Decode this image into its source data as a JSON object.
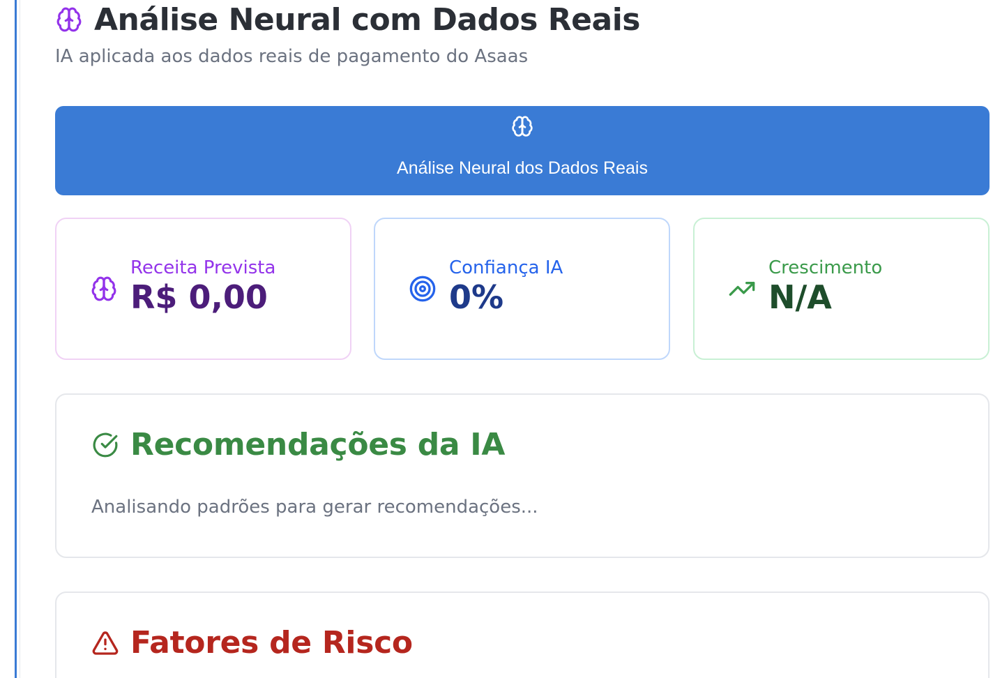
{
  "header": {
    "title": "Análise Neural com Dados Reais",
    "subtitle": "IA aplicada aos dados reais de pagamento do Asaas",
    "icon": "brain-icon"
  },
  "hero_button": {
    "label": "Análise Neural dos Dados Reais",
    "icon": "brain-icon"
  },
  "stats": [
    {
      "label": "Receita Prevista",
      "value": "R$ 0,00",
      "icon": "brain-icon",
      "accent": "#9333ea"
    },
    {
      "label": "Confiança IA",
      "value": "0%",
      "icon": "target-icon",
      "accent": "#2563eb"
    },
    {
      "label": "Crescimento",
      "value": "N/A",
      "icon": "trending-up-icon",
      "accent": "#3a9a4a"
    }
  ],
  "recommendations": {
    "title": "Recomendações da IA",
    "body": "Analisando padrões para gerar recomendações...",
    "icon": "check-circle-icon"
  },
  "risks": {
    "title": "Fatores de Risco",
    "icon": "alert-triangle-icon"
  },
  "colors": {
    "primary": "#3a7bd5",
    "purple": "#9333ea",
    "blue": "#2563eb",
    "green": "#3a9a4a",
    "red": "#b5261e"
  }
}
